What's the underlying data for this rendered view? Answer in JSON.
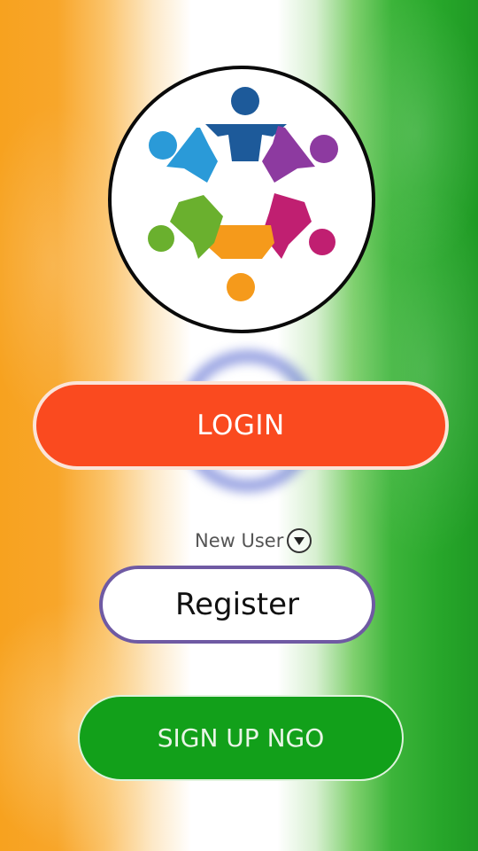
{
  "logo": {
    "icon": "people-circle-logo-icon"
  },
  "buttons": {
    "login_label": "LOGIN",
    "register_label": "Register",
    "signup_ngo_label": "SIGN UP NGO"
  },
  "new_user": {
    "label": "New User",
    "icon": "chevron-down-circle-icon"
  },
  "colors": {
    "login": "#fa4a1f",
    "register_border": "#6f5aa3",
    "signup_ngo": "#12a01a",
    "saffron": "#f7a21f",
    "green": "#1f9a24"
  }
}
